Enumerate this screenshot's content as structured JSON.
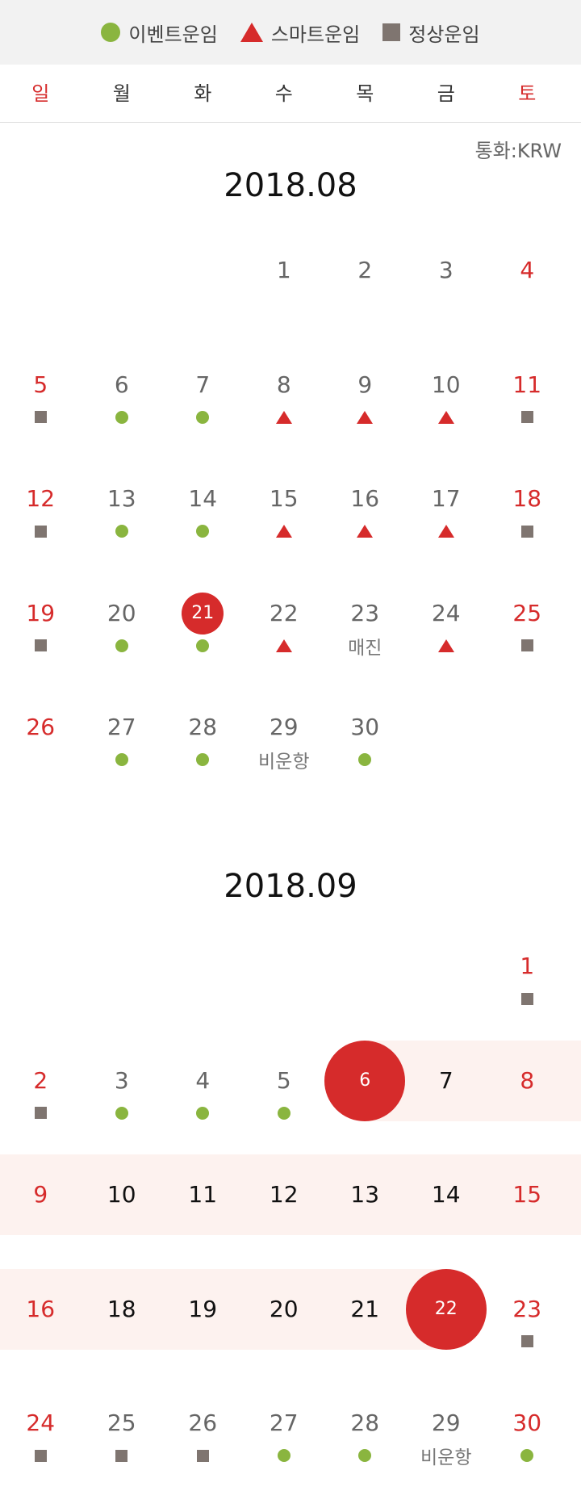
{
  "legend": [
    {
      "label": "이벤트운임",
      "icon": "circle",
      "color": "#8ab53f"
    },
    {
      "label": "스마트운임",
      "icon": "triangle",
      "color": "#d62b2b"
    },
    {
      "label": "정상운임",
      "icon": "square",
      "color": "#7f7570"
    }
  ],
  "weekdays": [
    "일",
    "월",
    "화",
    "수",
    "목",
    "금",
    "토"
  ],
  "currency": "통화:KRW",
  "months": [
    {
      "title": "2018.08",
      "days": [
        {
          "d": "1",
          "col": 3,
          "row": 0
        },
        {
          "d": "2",
          "col": 4,
          "row": 0
        },
        {
          "d": "3",
          "col": 5,
          "row": 0
        },
        {
          "d": "4",
          "col": 6,
          "row": 0
        },
        {
          "d": "5",
          "col": 0,
          "row": 1,
          "m": "square"
        },
        {
          "d": "6",
          "col": 1,
          "row": 1,
          "m": "circle"
        },
        {
          "d": "7",
          "col": 2,
          "row": 1,
          "m": "circle"
        },
        {
          "d": "8",
          "col": 3,
          "row": 1,
          "m": "triangle"
        },
        {
          "d": "9",
          "col": 4,
          "row": 1,
          "m": "triangle"
        },
        {
          "d": "10",
          "col": 5,
          "row": 1,
          "m": "triangle"
        },
        {
          "d": "11",
          "col": 6,
          "row": 1,
          "m": "square"
        },
        {
          "d": "12",
          "col": 0,
          "row": 2,
          "m": "square"
        },
        {
          "d": "13",
          "col": 1,
          "row": 2,
          "m": "circle"
        },
        {
          "d": "14",
          "col": 2,
          "row": 2,
          "m": "circle"
        },
        {
          "d": "15",
          "col": 3,
          "row": 2,
          "m": "triangle"
        },
        {
          "d": "16",
          "col": 4,
          "row": 2,
          "m": "triangle"
        },
        {
          "d": "17",
          "col": 5,
          "row": 2,
          "m": "triangle"
        },
        {
          "d": "18",
          "col": 6,
          "row": 2,
          "m": "square"
        },
        {
          "d": "19",
          "col": 0,
          "row": 3,
          "m": "square"
        },
        {
          "d": "20",
          "col": 1,
          "row": 3,
          "m": "circle"
        },
        {
          "d": "21",
          "col": 2,
          "row": 3,
          "m": "circle",
          "today": true
        },
        {
          "d": "22",
          "col": 3,
          "row": 3,
          "m": "triangle"
        },
        {
          "d": "23",
          "col": 4,
          "row": 3,
          "label": "매진"
        },
        {
          "d": "24",
          "col": 5,
          "row": 3,
          "m": "triangle"
        },
        {
          "d": "25",
          "col": 6,
          "row": 3,
          "m": "square"
        },
        {
          "d": "26",
          "col": 0,
          "row": 4
        },
        {
          "d": "27",
          "col": 1,
          "row": 4,
          "m": "circle"
        },
        {
          "d": "28",
          "col": 2,
          "row": 4,
          "m": "circle"
        },
        {
          "d": "29",
          "col": 3,
          "row": 4,
          "label": "비운항"
        },
        {
          "d": "30",
          "col": 4,
          "row": 4,
          "m": "circle"
        }
      ]
    },
    {
      "title": "2018.09",
      "days": [
        {
          "d": "1",
          "col": 6,
          "row": 0,
          "m": "square"
        },
        {
          "d": "2",
          "col": 0,
          "row": 1,
          "m": "square"
        },
        {
          "d": "3",
          "col": 1,
          "row": 1,
          "m": "circle"
        },
        {
          "d": "4",
          "col": 2,
          "row": 1,
          "m": "circle"
        },
        {
          "d": "5",
          "col": 3,
          "row": 1,
          "m": "circle"
        },
        {
          "d": "6",
          "col": 4,
          "row": 1,
          "selected": true
        },
        {
          "d": "7",
          "col": 5,
          "row": 1,
          "range": true
        },
        {
          "d": "8",
          "col": 6,
          "row": 1,
          "range": true
        },
        {
          "d": "9",
          "col": 0,
          "row": 2,
          "range": true
        },
        {
          "d": "10",
          "col": 1,
          "row": 2,
          "range": true
        },
        {
          "d": "11",
          "col": 2,
          "row": 2,
          "range": true
        },
        {
          "d": "12",
          "col": 3,
          "row": 2,
          "range": true
        },
        {
          "d": "13",
          "col": 4,
          "row": 2,
          "range": true
        },
        {
          "d": "14",
          "col": 5,
          "row": 2,
          "range": true
        },
        {
          "d": "15",
          "col": 6,
          "row": 2,
          "range": true
        },
        {
          "d": "16",
          "col": 0,
          "row": 3,
          "range": true
        },
        {
          "d": "18",
          "col": 1,
          "row": 3,
          "range": true
        },
        {
          "d": "19",
          "col": 2,
          "row": 3,
          "range": true
        },
        {
          "d": "20",
          "col": 3,
          "row": 3,
          "range": true
        },
        {
          "d": "21",
          "col": 4,
          "row": 3,
          "range": true
        },
        {
          "d": "22",
          "col": 5,
          "row": 3,
          "selected": true
        },
        {
          "d": "23",
          "col": 6,
          "row": 3,
          "m": "square"
        },
        {
          "d": "24",
          "col": 0,
          "row": 4,
          "m": "square"
        },
        {
          "d": "25",
          "col": 1,
          "row": 4,
          "m": "square"
        },
        {
          "d": "26",
          "col": 2,
          "row": 4,
          "m": "square"
        },
        {
          "d": "27",
          "col": 3,
          "row": 4,
          "m": "circle"
        },
        {
          "d": "28",
          "col": 4,
          "row": 4,
          "m": "circle"
        },
        {
          "d": "29",
          "col": 5,
          "row": 4,
          "label": "비운항"
        },
        {
          "d": "30",
          "col": 6,
          "row": 4,
          "m": "circle"
        }
      ]
    }
  ]
}
